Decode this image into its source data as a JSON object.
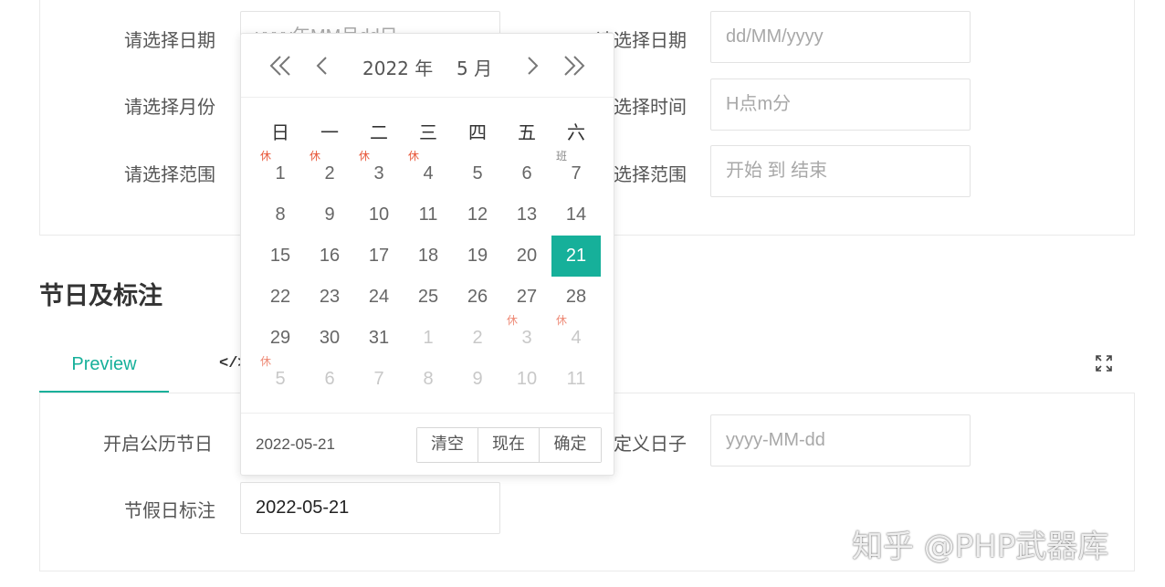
{
  "form_top": {
    "left": [
      {
        "label": "请选择日期",
        "value": "",
        "placeholder": "yyyy年MM月dd日"
      },
      {
        "label": "请选择月份"
      },
      {
        "label": "请选择范围"
      }
    ],
    "right": [
      {
        "label": "请选择日期",
        "placeholder": "dd/MM/yyyy"
      },
      {
        "label": "请选择时间",
        "placeholder": "H点m分"
      },
      {
        "label": "请选择范围",
        "placeholder": "开始 到 结束"
      }
    ]
  },
  "section": {
    "title": "节日及标注"
  },
  "tabs": {
    "preview": "Preview",
    "code": "</>"
  },
  "form_bottom": {
    "left": [
      {
        "label": "开启公历节日"
      },
      {
        "label": "节假日标注",
        "value": "2022-05-21"
      }
    ],
    "right": [
      {
        "label": "自定义日子",
        "placeholder": "yyyy-MM-dd"
      }
    ]
  },
  "picker": {
    "year": "2022 年",
    "month": "5 月",
    "weekdays": [
      "日",
      "一",
      "二",
      "三",
      "四",
      "五",
      "六"
    ],
    "weeks": [
      [
        {
          "d": "1",
          "m": "休"
        },
        {
          "d": "2",
          "m": "休"
        },
        {
          "d": "3",
          "m": "休"
        },
        {
          "d": "4",
          "m": "休"
        },
        {
          "d": "5"
        },
        {
          "d": "6"
        },
        {
          "d": "7",
          "m": "班"
        }
      ],
      [
        {
          "d": "8"
        },
        {
          "d": "9"
        },
        {
          "d": "10"
        },
        {
          "d": "11"
        },
        {
          "d": "12"
        },
        {
          "d": "13"
        },
        {
          "d": "14"
        }
      ],
      [
        {
          "d": "15"
        },
        {
          "d": "16"
        },
        {
          "d": "17"
        },
        {
          "d": "18"
        },
        {
          "d": "19"
        },
        {
          "d": "20"
        },
        {
          "d": "21",
          "sel": true
        }
      ],
      [
        {
          "d": "22"
        },
        {
          "d": "23"
        },
        {
          "d": "24"
        },
        {
          "d": "25"
        },
        {
          "d": "26"
        },
        {
          "d": "27"
        },
        {
          "d": "28"
        }
      ],
      [
        {
          "d": "29"
        },
        {
          "d": "30"
        },
        {
          "d": "31"
        },
        {
          "d": "1",
          "o": true
        },
        {
          "d": "2",
          "o": true
        },
        {
          "d": "3",
          "o": true,
          "m": "休"
        },
        {
          "d": "4",
          "o": true,
          "m": "休"
        }
      ],
      [
        {
          "d": "5",
          "o": true,
          "m": "休"
        },
        {
          "d": "6",
          "o": true
        },
        {
          "d": "7",
          "o": true
        },
        {
          "d": "8",
          "o": true
        },
        {
          "d": "9",
          "o": true
        },
        {
          "d": "10",
          "o": true
        },
        {
          "d": "11",
          "o": true
        }
      ]
    ],
    "footer_value": "2022-05-21",
    "buttons": {
      "clear": "清空",
      "now": "现在",
      "confirm": "确定"
    }
  },
  "watermark": "知乎 @PHP武器库",
  "colors": {
    "accent": "#16b09a",
    "rest_mark": "#e8593b"
  }
}
